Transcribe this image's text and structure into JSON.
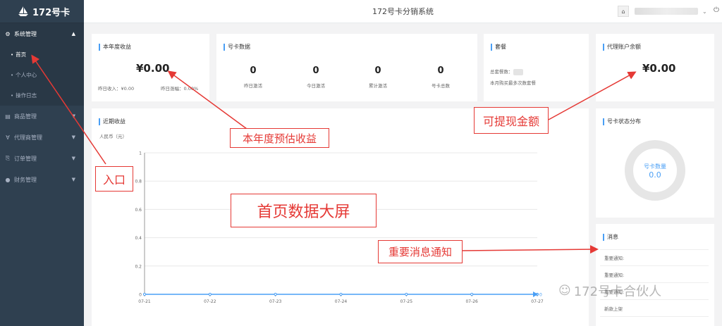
{
  "sidebar": {
    "logo": "172号卡",
    "groups": [
      {
        "label": "系统管理",
        "icon": "gear-icon",
        "children": [
          "首页",
          "个人中心",
          "操作日志"
        ]
      },
      {
        "label": "商品管理",
        "icon": "book-icon"
      },
      {
        "label": "代理商管理",
        "icon": "agent-icon"
      },
      {
        "label": "订单管理",
        "icon": "order-icon"
      },
      {
        "label": "财务管理",
        "icon": "money-icon"
      }
    ]
  },
  "topbar": {
    "title": "172号卡分销系统"
  },
  "cards": {
    "annual": {
      "title": "本年度收益",
      "value": "¥0.00",
      "yesterday_income": "昨日收入：¥0.00",
      "yesterday_rate": "昨日涨幅：0.00%"
    },
    "card_data": {
      "title": "号卡数据",
      "stats": [
        {
          "value": "0",
          "label": "昨日激活"
        },
        {
          "value": "0",
          "label": "今日激活"
        },
        {
          "value": "0",
          "label": "累计激活"
        },
        {
          "value": "0",
          "label": "号卡总数"
        }
      ]
    },
    "package": {
      "title": "套餐",
      "total_label": "总套餐数：",
      "monthly_note": "本月购买最多次数套餐"
    },
    "balance": {
      "title": "代理账户余额",
      "value": "¥0.00"
    },
    "recent": {
      "title": "近期收益",
      "unit": "人民币（元）"
    },
    "status": {
      "title": "号卡状态分布",
      "center_label": "号卡数量",
      "center_value": "0.0"
    },
    "messages": {
      "title": "消息",
      "items": [
        "重要通知:",
        "重要通知:",
        "重要通知:",
        "新款上架"
      ]
    }
  },
  "chart_data": {
    "type": "line",
    "x": [
      "07-21",
      "07-22",
      "07-23",
      "07-24",
      "07-25",
      "07-26",
      "07-27"
    ],
    "series": [
      {
        "values": [
          0,
          0,
          0,
          0,
          0,
          0,
          0
        ]
      }
    ],
    "yticks": [
      "0",
      "0.2",
      "0.4",
      "0.6",
      "0.8",
      "1"
    ],
    "ylim": [
      0,
      1
    ],
    "end_label": "0",
    "grid": true,
    "color": "#4a9ff5"
  },
  "annotations": {
    "entry": "入口",
    "annual_forecast": "本年度预估收益",
    "withdrawable": "可提现金额",
    "dashboard": "首页数据大屏",
    "notice": "重要消息通知"
  },
  "watermark": "172号卡合伙人",
  "colors": {
    "sidebar": "#2f4050",
    "accent": "#4a9ff5",
    "annotation": "#e53935"
  }
}
